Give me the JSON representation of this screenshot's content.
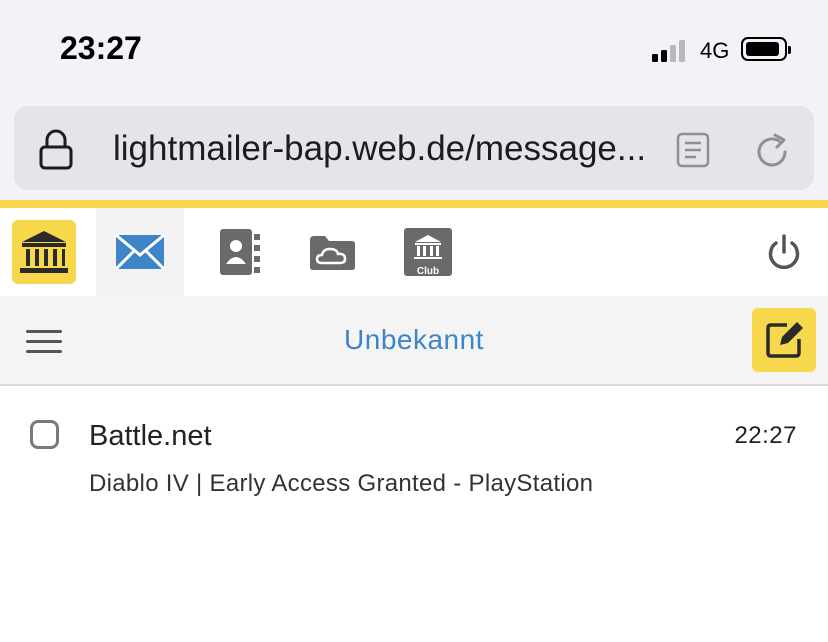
{
  "status_bar": {
    "time": "23:27",
    "network": "4G",
    "signal_bars_active": 2,
    "signal_bars_total": 4
  },
  "browser": {
    "url": "lightmailer-bap.web.de/message...",
    "icons": [
      "lock-icon",
      "reader-icon",
      "reload-icon"
    ]
  },
  "app_nav": {
    "accent_color": "#f7d84c",
    "items": [
      {
        "icon": "home-icon",
        "active": false
      },
      {
        "icon": "mail-icon",
        "active": true
      },
      {
        "icon": "contacts-icon",
        "active": false
      },
      {
        "icon": "cloud-icon",
        "active": false
      },
      {
        "icon": "club-icon",
        "label": "Club",
        "active": false
      },
      {
        "icon": "power-icon",
        "active": false
      }
    ]
  },
  "toolbar": {
    "folder_title": "Unbekannt",
    "title_color": "#3d85c6",
    "compose_icon": "compose-icon"
  },
  "mail_list": [
    {
      "sender": "Battle.net",
      "time": "22:27",
      "subject": "Diablo IV | Early Access Granted - PlayStation",
      "checked": false
    }
  ]
}
